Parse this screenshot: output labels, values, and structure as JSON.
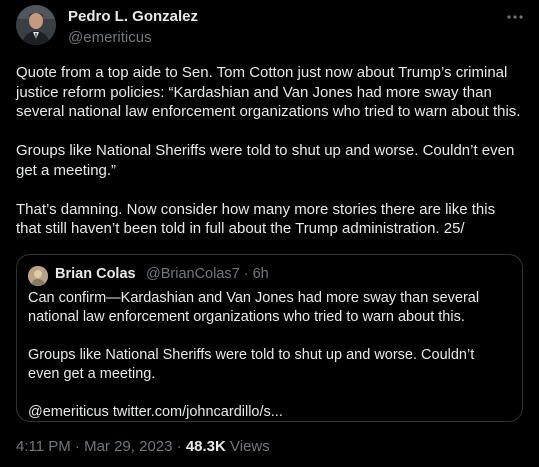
{
  "author": {
    "name": "Pedro L. Gonzalez",
    "handle": "@emeriticus"
  },
  "more_icon": "more-horizontal-icon",
  "tweet": {
    "paragraphs": [
      "Quote from a top aide to Sen. Tom Cotton just now about Trump’s criminal justice reform policies: “Kardashian and Van Jones had more sway than several national law enforcement organizations who tried to warn about this.",
      "Groups like National Sheriffs were told to shut up and worse. Couldn’t even get a meeting.”",
      "That’s damning. Now consider how many more stories there are like this that still haven’t been told in full about the Trump administration. 25/"
    ]
  },
  "quoted": {
    "name": "Brian Colas",
    "meta": "@BrianColas7 · 6h",
    "paragraphs": [
      "Can confirm—Kardashian and Van Jones had more sway than several national law enforcement organizations who tried to warn about this.",
      "Groups like National Sheriffs were told to shut up and worse. Couldn’t even get a meeting.",
      "@emeriticus twitter.com/johncardillo/s..."
    ]
  },
  "footer": {
    "timestamp": "4:11 PM · Mar 29, 2023 · ",
    "views_count": "48.3K",
    "views_label": " Views"
  },
  "colors": {
    "background": "#000000",
    "text": "#e7e9ea",
    "secondary": "#71767b",
    "border": "#2f3336"
  }
}
